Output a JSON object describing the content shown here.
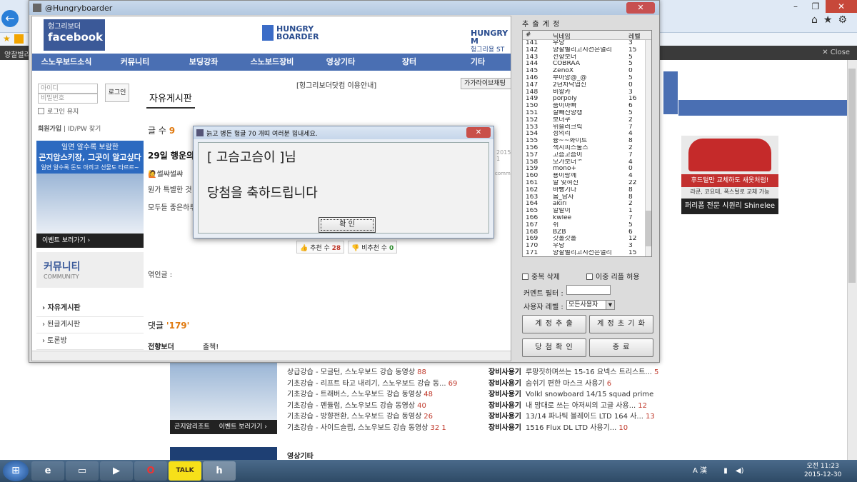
{
  "browser": {
    "tab_label": "양찰별리",
    "close_label": "✕ Close",
    "icons": [
      "home-icon",
      "star-icon",
      "gear-icon"
    ]
  },
  "bg_lists": {
    "left": [
      {
        "text": "상급강습 - 모글턴, 스노우보드 강습 동영상",
        "n": "88"
      },
      {
        "text": "기초강습 - 리프트 타고 내리기, 스노우보드 강습 동...",
        "n": "69"
      },
      {
        "text": "기초강습 - 트래버스, 스노우보드 강습 동영상",
        "n": "48"
      },
      {
        "text": "기초강습 - 펜듈럼, 스노우보드 강습 동영상",
        "n": "40"
      },
      {
        "text": "기초강습 - 방향전환, 스노우보드 강습 동영상",
        "n": "26"
      },
      {
        "text": "기초강습 - 사이드슬립, 스노우보드 강습 동영상",
        "n": "32 1"
      }
    ],
    "right": [
      {
        "cat": "장비사용기",
        "text": "루팡짓하며쓰는 15-16 요넥스 트리스트...",
        "n": "5"
      },
      {
        "cat": "장비사용기",
        "text": "숨쉬기 편한 마스크 사용기",
        "n": "6"
      },
      {
        "cat": "장비사용기",
        "text": "Volkl snowboard 14/15 squad prime",
        "n": ""
      },
      {
        "cat": "장비사용기",
        "text": "내 맘대로 쓰는 아저씨의 고글 사용...",
        "n": "12"
      },
      {
        "cat": "장비사용기",
        "text": "13/14 파나틱 블레이드 LTD 164 사...",
        "n": "13"
      },
      {
        "cat": "장비사용기",
        "text": "1516 Flux DL LTD 사용기...",
        "n": "10"
      }
    ],
    "video_header": "영상기타",
    "ad_footer": "이벤트 보러가기 ›",
    "ad_brand": "곤지암리조트"
  },
  "right_ad": {
    "line1": "후드털만 교체하도 새옷처럼!",
    "line2": "라쿤, 코요테, 폭스털로 교체 가능",
    "line3": "퍼리폼 전문 시원리 Shinelee"
  },
  "app": {
    "title": "@Hungryboarder",
    "close": "✕",
    "site": {
      "fb_line1": "헝그리보더",
      "fb_line2": "facebook",
      "logo_center_1": "HUNGRY",
      "logo_center_2": "BOARDER",
      "logo_right_1": "HUNGRY M",
      "logo_right_2": "헝그리용 ST",
      "nav": [
        "스노우보드소식",
        "커뮤니티",
        "보딩강좌",
        "스노보드장비",
        "영상기타",
        "장터",
        "기타"
      ],
      "id_placeholder": "아이디",
      "pw_placeholder": "비밀번호",
      "login": "로그인",
      "keep_login": "로그인 유지",
      "join": "회원가입",
      "find": "ID/PW 찾기",
      "ad_head1": "일면 알수록 보람한",
      "ad_head2": "곤지암스키장, 그곳이 알고싶다",
      "ad_head3": "일면 알수록 돈도 아끼고 선물도 타르르~",
      "ad_footer": "이벤트 보러가기 ›",
      "community": "커뮤니티",
      "community_en": "COMMUNITY",
      "menu": [
        "› 자유게시판",
        "› 된글게시판",
        "› 토론방"
      ],
      "board_title": "자유게시판",
      "notice": "[헝그리보더닷컴 이용안내]",
      "chat_btn": "가가라이브채팅",
      "count_label": "글 수",
      "count": "9",
      "post_title": "29일 행운의",
      "post_date": "2015-1",
      "post_user": "🙋썰쌰썰쌰",
      "post_text1": "뭔가 특별한 것",
      "post_text2": "모두들 좋은하루",
      "rec_label": "추천 수",
      "rec": "28",
      "nrec_label": "비추천 수",
      "nrec": "0",
      "link_label": "엮인글 :",
      "cmt_label": "댓글",
      "cmt": "'179'",
      "cmt_user": "전향보더",
      "cmt_text": "출첵!",
      "comment_tag": "comment"
    },
    "panel": {
      "label": "추 출 계 정",
      "head": [
        "#",
        "닉네임",
        "레벨"
      ],
      "rows": [
        [
          "141",
          "우당",
          "3"
        ],
        [
          "142",
          "양찰별리고시선은멀리",
          "15"
        ],
        [
          "143",
          "전향보더",
          "5"
        ],
        [
          "144",
          "COBRAA",
          "5"
        ],
        [
          "145",
          "ZenoX",
          "0"
        ],
        [
          "146",
          "부아앙@_@",
          "5"
        ],
        [
          "147",
          "2년차낙엽신",
          "0"
        ],
        [
          "148",
          "비왕카",
          "3"
        ],
        [
          "149",
          "porpoly",
          "16"
        ],
        [
          "150",
          "숨이아빠",
          "6"
        ],
        [
          "151",
          "살빼진양캥",
          "5"
        ],
        [
          "152",
          "보더쿠",
          "2"
        ],
        [
          "153",
          "위슬러크릭",
          "7"
        ],
        [
          "154",
          "정의리",
          "4"
        ],
        [
          "155",
          "슝~~화이트",
          "8"
        ],
        [
          "156",
          "색시피스툴즈",
          "2"
        ],
        [
          "157",
          "고슴고슴이",
          "7"
        ],
        [
          "158",
          "모가보더™",
          "4"
        ],
        [
          "159",
          "mono+",
          "0"
        ],
        [
          "160",
          "용이랑께",
          "4"
        ],
        [
          "161",
          "말 잊혀진",
          "22"
        ],
        [
          "162",
          "바빵기다",
          "8"
        ],
        [
          "163",
          "봄_남자",
          "8"
        ],
        [
          "164",
          "akiri",
          "2"
        ],
        [
          "165",
          "알랄이",
          "1"
        ],
        [
          "166",
          "kwlee",
          "7"
        ],
        [
          "167",
          "쉬",
          "5"
        ],
        [
          "168",
          "BZB",
          "6"
        ],
        [
          "169",
          "갓홀갓홀",
          "12"
        ],
        [
          "170",
          "우당",
          "3"
        ],
        [
          "171",
          "양찰별리고시선은멀리",
          "15"
        ]
      ],
      "dup_delete": "중복 삭제",
      "allow_dup_reply": "이중 리플 허용",
      "comment_filter": "커멘트 필터 :",
      "user_level": "사용자 레벨 :",
      "level_value": "모든사용자",
      "btn_extract": "계 정 추 출",
      "btn_reset": "계 정 초 기 화",
      "btn_winner": "당 첨 확 인",
      "btn_exit": "종 료"
    }
  },
  "dialog": {
    "title": "늙고 병든 헝글 70 개띠 여러분 힘내세요.",
    "line1": "[ 고슴고슴이 ]님",
    "line2": "당첨을 축하드립니다",
    "ok": "확 인",
    "close": "✕"
  },
  "taskbar": {
    "talk": "TALK",
    "ime": "A 漢",
    "time": "오전 11:23",
    "date": "2015-12-30"
  }
}
